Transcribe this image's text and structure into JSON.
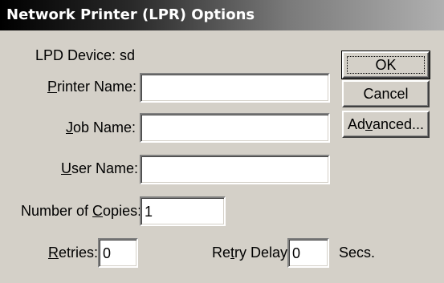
{
  "window": {
    "title": "Network Printer (LPR) Options"
  },
  "device": {
    "label": "LPD Device: sd"
  },
  "printer_name": {
    "label_u": "P",
    "label_rest": "rinter Name:",
    "value": ""
  },
  "job_name": {
    "label_u": "J",
    "label_rest": "ob Name:",
    "value": ""
  },
  "user_name": {
    "label_u": "U",
    "label_rest": "ser Name:",
    "value": ""
  },
  "copies": {
    "label_pre": "Number of ",
    "label_u": "C",
    "label_rest": "opies:",
    "value": "1"
  },
  "retries": {
    "label_u": "R",
    "label_rest": "etries:",
    "value": "0"
  },
  "retry_delay": {
    "label_pre": "Re",
    "label_u": "t",
    "label_rest": "ry Delay:",
    "value": "0",
    "unit": "Secs."
  },
  "buttons": {
    "ok": "OK",
    "cancel": "Cancel",
    "advanced_pre": "Ad",
    "advanced_u": "v",
    "advanced_rest": "anced..."
  }
}
